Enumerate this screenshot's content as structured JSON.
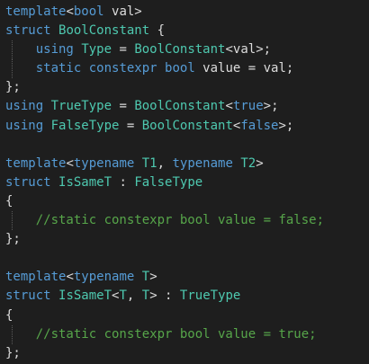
{
  "editor": {
    "colors": {
      "background": "#1e1e1e",
      "keyword": "#569cd6",
      "type": "#4ec9b0",
      "plain": "#dcdcdc",
      "comment": "#57a64a",
      "guide": "#5a5a5a"
    },
    "lines": [
      {
        "guide": false,
        "tokens": [
          {
            "t": "template",
            "c": "keyword"
          },
          {
            "t": "<",
            "c": "plain"
          },
          {
            "t": "bool",
            "c": "keyword"
          },
          {
            "t": " val>",
            "c": "plain"
          }
        ]
      },
      {
        "guide": false,
        "tokens": [
          {
            "t": "struct",
            "c": "keyword"
          },
          {
            "t": " ",
            "c": "plain"
          },
          {
            "t": "BoolConstant",
            "c": "type"
          },
          {
            "t": " {",
            "c": "plain"
          }
        ]
      },
      {
        "guide": true,
        "tokens": [
          {
            "t": "    ",
            "c": "plain"
          },
          {
            "t": "using",
            "c": "keyword"
          },
          {
            "t": " ",
            "c": "plain"
          },
          {
            "t": "Type",
            "c": "type"
          },
          {
            "t": " = ",
            "c": "plain"
          },
          {
            "t": "BoolConstant",
            "c": "type"
          },
          {
            "t": "<val>;",
            "c": "plain"
          }
        ]
      },
      {
        "guide": true,
        "tokens": [
          {
            "t": "    ",
            "c": "plain"
          },
          {
            "t": "static",
            "c": "keyword"
          },
          {
            "t": " ",
            "c": "plain"
          },
          {
            "t": "constexpr",
            "c": "keyword"
          },
          {
            "t": " ",
            "c": "plain"
          },
          {
            "t": "bool",
            "c": "keyword"
          },
          {
            "t": " value = val;",
            "c": "plain"
          }
        ]
      },
      {
        "guide": false,
        "tokens": [
          {
            "t": "};",
            "c": "plain"
          }
        ]
      },
      {
        "guide": false,
        "tokens": [
          {
            "t": "using",
            "c": "keyword"
          },
          {
            "t": " ",
            "c": "plain"
          },
          {
            "t": "TrueType",
            "c": "type"
          },
          {
            "t": " = ",
            "c": "plain"
          },
          {
            "t": "BoolConstant",
            "c": "type"
          },
          {
            "t": "<",
            "c": "plain"
          },
          {
            "t": "true",
            "c": "keyword"
          },
          {
            "t": ">;",
            "c": "plain"
          }
        ]
      },
      {
        "guide": false,
        "tokens": [
          {
            "t": "using",
            "c": "keyword"
          },
          {
            "t": " ",
            "c": "plain"
          },
          {
            "t": "FalseType",
            "c": "type"
          },
          {
            "t": " = ",
            "c": "plain"
          },
          {
            "t": "BoolConstant",
            "c": "type"
          },
          {
            "t": "<",
            "c": "plain"
          },
          {
            "t": "false",
            "c": "keyword"
          },
          {
            "t": ">;",
            "c": "plain"
          }
        ]
      },
      {
        "guide": false,
        "tokens": []
      },
      {
        "guide": false,
        "tokens": [
          {
            "t": "template",
            "c": "keyword"
          },
          {
            "t": "<",
            "c": "plain"
          },
          {
            "t": "typename",
            "c": "keyword"
          },
          {
            "t": " ",
            "c": "plain"
          },
          {
            "t": "T1",
            "c": "type"
          },
          {
            "t": ", ",
            "c": "plain"
          },
          {
            "t": "typename",
            "c": "keyword"
          },
          {
            "t": " ",
            "c": "plain"
          },
          {
            "t": "T2",
            "c": "type"
          },
          {
            "t": ">",
            "c": "plain"
          }
        ]
      },
      {
        "guide": false,
        "tokens": [
          {
            "t": "struct",
            "c": "keyword"
          },
          {
            "t": " ",
            "c": "plain"
          },
          {
            "t": "IsSameT",
            "c": "type"
          },
          {
            "t": " : ",
            "c": "plain"
          },
          {
            "t": "FalseType",
            "c": "type"
          }
        ]
      },
      {
        "guide": false,
        "tokens": [
          {
            "t": "{",
            "c": "plain"
          }
        ]
      },
      {
        "guide": true,
        "tokens": [
          {
            "t": "    ",
            "c": "plain"
          },
          {
            "t": "//static constexpr bool value = false;",
            "c": "comment"
          }
        ]
      },
      {
        "guide": false,
        "tokens": [
          {
            "t": "};",
            "c": "plain"
          }
        ]
      },
      {
        "guide": false,
        "tokens": []
      },
      {
        "guide": false,
        "tokens": [
          {
            "t": "template",
            "c": "keyword"
          },
          {
            "t": "<",
            "c": "plain"
          },
          {
            "t": "typename",
            "c": "keyword"
          },
          {
            "t": " ",
            "c": "plain"
          },
          {
            "t": "T",
            "c": "type"
          },
          {
            "t": ">",
            "c": "plain"
          }
        ]
      },
      {
        "guide": false,
        "tokens": [
          {
            "t": "struct",
            "c": "keyword"
          },
          {
            "t": " ",
            "c": "plain"
          },
          {
            "t": "IsSameT",
            "c": "type"
          },
          {
            "t": "<",
            "c": "plain"
          },
          {
            "t": "T",
            "c": "type"
          },
          {
            "t": ", ",
            "c": "plain"
          },
          {
            "t": "T",
            "c": "type"
          },
          {
            "t": "> : ",
            "c": "plain"
          },
          {
            "t": "TrueType",
            "c": "type"
          }
        ]
      },
      {
        "guide": false,
        "tokens": [
          {
            "t": "{",
            "c": "plain"
          }
        ]
      },
      {
        "guide": true,
        "tokens": [
          {
            "t": "    ",
            "c": "plain"
          },
          {
            "t": "//static constexpr bool value = true;",
            "c": "comment"
          }
        ]
      },
      {
        "guide": false,
        "tokens": [
          {
            "t": "};",
            "c": "plain"
          }
        ]
      }
    ]
  }
}
